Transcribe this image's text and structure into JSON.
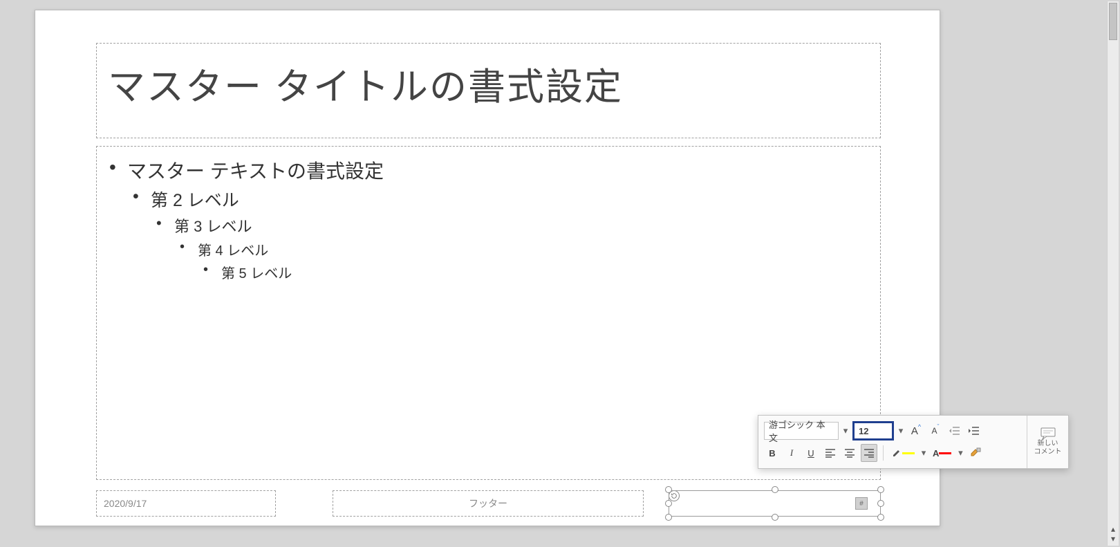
{
  "slide": {
    "title": "マスター タイトルの書式設定",
    "body": {
      "l1": "マスター テキストの書式設定",
      "l2": "第 2 レベル",
      "l3": "第 3 レベル",
      "l4": "第 4 レベル",
      "l5": "第 5 レベル"
    },
    "date": "2020/9/17",
    "footer": "フッター",
    "slide_number_placeholder": "‹#›"
  },
  "mini_toolbar": {
    "font_name": "游ゴシック 本文",
    "font_size": "12",
    "grow_font_label": "A",
    "shrink_font_label": "A",
    "bold": "B",
    "italic": "I",
    "underline": "U",
    "highlight_color": "#ffff00",
    "font_color": "#ff0000",
    "comment_label_1": "新しい",
    "comment_label_2": "コメント"
  }
}
